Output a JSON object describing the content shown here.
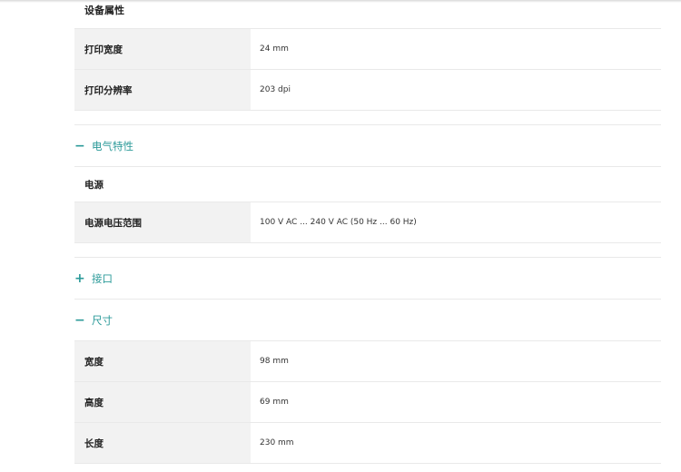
{
  "device_properties": {
    "heading": "设备属性",
    "rows": [
      {
        "label": "打印宽度",
        "value": "24 mm"
      },
      {
        "label": "打印分辨率",
        "value": "203 dpi"
      }
    ]
  },
  "electrical": {
    "sign": "−",
    "title": "电气特性",
    "subheading": "电源",
    "rows": [
      {
        "label": "电源电压范围",
        "value": "100 V AC ... 240 V AC (50 Hz ... 60 Hz)"
      }
    ]
  },
  "interface": {
    "sign": "+",
    "title": "接口"
  },
  "dimensions": {
    "sign": "−",
    "title": "尺寸",
    "rows": [
      {
        "label": "宽度",
        "value": "98 mm"
      },
      {
        "label": "高度",
        "value": "69 mm"
      },
      {
        "label": "长度",
        "value": "230 mm"
      }
    ]
  },
  "colors": {
    "accent": "#2b9a99",
    "key_background": "#f2f2f2",
    "divider": "#e9e9e9"
  }
}
